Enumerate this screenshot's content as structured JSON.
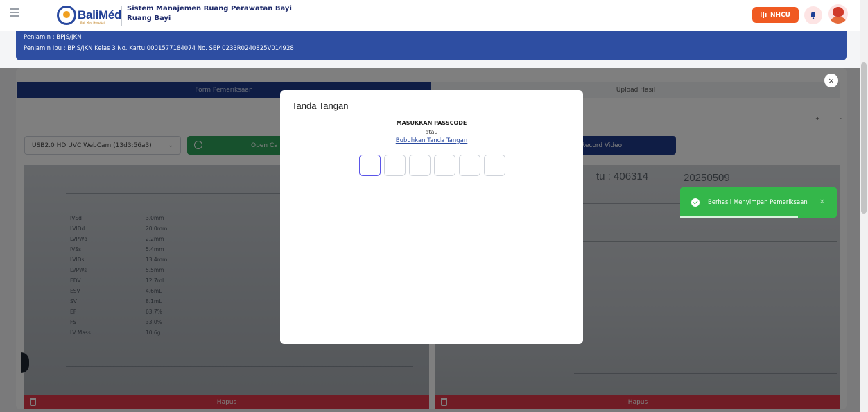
{
  "header": {
    "logo_text": "BaliMéd",
    "logo_tagline": "Bali Med Hospital",
    "app_title": "Sistem Manajemen Ruang Perawatan Bayi",
    "app_subtitle": "Ruang Bayi",
    "nhcu_label": "NHCU",
    "colors": {
      "accent": "#f05a22",
      "brand": "#1f3f95"
    }
  },
  "info": {
    "penjamin": "Penjamin : BPJS/JKN",
    "penjamin_ibu": "Penjamin Ibu : BPJS/JKN Kelas 3 No. Kartu 0001577184074 No. SEP 0233R0240825V014928"
  },
  "tabs": {
    "form": "Form Pemeriksaan",
    "upload": "Upload Hasil"
  },
  "controls": {
    "camera_select": "USB2.0 HD UVC WebCam (13d3:56a3)",
    "open_camera": "Open Ca",
    "record_video": "Record Video",
    "zoom_plus": "+",
    "zoom_minus": "-"
  },
  "images": {
    "right_text_1": "tu : 406314",
    "right_text_2": "20250509",
    "left_labels": [
      "IVSd",
      "LVIDd",
      "LVPWd",
      "IVSs",
      "LVIDs",
      "LVPWs",
      "EDV",
      "ESV",
      "SV",
      "EF",
      "FS",
      "LV Mass"
    ],
    "left_values": [
      "3.0mm",
      "20.0mm",
      "2.2mm",
      "5.4mm",
      "13.4mm",
      "5.5mm",
      "12.7mL",
      "4.6mL",
      "8.1mL",
      "63.7%",
      "33.0%",
      "10.6g"
    ],
    "delete_label": "Hapus"
  },
  "modal": {
    "title": "Tanda Tangan",
    "passcode_label": "MASUKKAN PASSCODE",
    "or_label": "atau",
    "sign_link": "Bubuhkan Tanda Tangan",
    "passcode_digits": [
      "",
      "",
      "",
      "",
      "",
      ""
    ]
  },
  "toast": {
    "message": "Berhasil Menyimpan Pemeriksaan",
    "close": "×",
    "color": "#34b74a"
  },
  "close_button": "×"
}
